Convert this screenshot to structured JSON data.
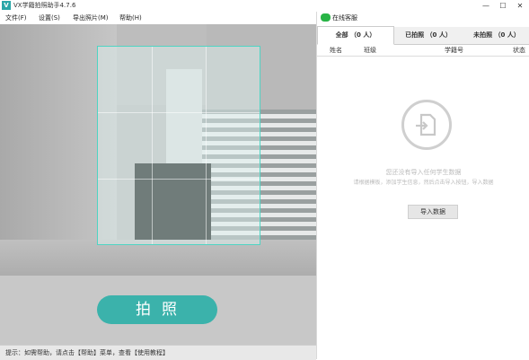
{
  "window": {
    "title": "VX学籍拍照助手4.7.6",
    "app_icon": "V"
  },
  "window_controls": {
    "minimize": "—",
    "maximize": "☐",
    "close": "✕"
  },
  "menu": [
    "文件(F)",
    "设置(S)",
    "导出照片(M)",
    "帮助(H)"
  ],
  "camera": {
    "shoot_label": "拍照"
  },
  "statusbar": {
    "text": "提示：如需帮助，请点击【帮助】菜单，查看【使用教程】"
  },
  "service": {
    "label": "在线客服",
    "icon": "wechat-icon"
  },
  "tabs": [
    {
      "label": "全部 （0 人）",
      "active": true
    },
    {
      "label": "已拍照 （0 人）",
      "active": false
    },
    {
      "label": "未拍照 （0 人）",
      "active": false
    }
  ],
  "table": {
    "columns": [
      "姓名",
      "班级",
      "学籍号",
      "状态"
    ]
  },
  "empty_state": {
    "icon": "import-file-icon",
    "title": "您还没有导入任何学生数据",
    "subtitle": "请根据模板，添加学生信息，然后点击导入按钮，导入数据",
    "button_label": "导入数据"
  },
  "colors": {
    "accent": "#3bb2ab",
    "frame": "#4fd4c3",
    "wechat": "#28b446"
  }
}
